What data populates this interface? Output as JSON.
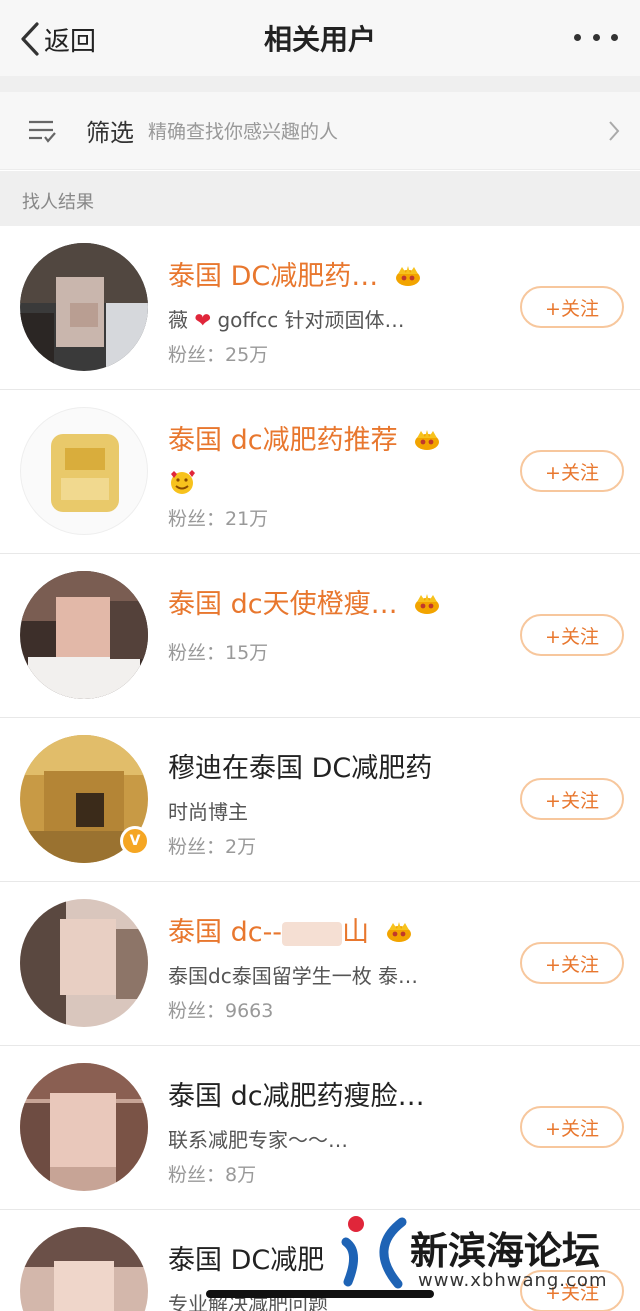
{
  "header": {
    "back_label": "返回",
    "title": "相关用户"
  },
  "filter": {
    "label": "筛选",
    "hint": "精确查找你感兴趣的人"
  },
  "section": {
    "label": "找人结果"
  },
  "follow_label": "+关注",
  "users": [
    {
      "name": "泰国 DC减肥药…",
      "desc_prefix": "薇",
      "desc_suffix": "goffcc  针对顽固体…",
      "fans": "粉丝：25万"
    },
    {
      "name": "泰国 dc减肥药推荐",
      "fans": "粉丝：21万"
    },
    {
      "name": "泰国 dc天使橙瘦…",
      "fans": "粉丝：15万"
    },
    {
      "name": "穆迪在泰国 DC减肥药",
      "desc": "时尚博主",
      "fans": "粉丝：2万"
    },
    {
      "name": "泰国 dc--",
      "name_tail": "山",
      "desc": "泰国dc泰国留学生一枚 泰…",
      "fans": "粉丝：9663"
    },
    {
      "name": "泰国 dc减肥药瘦脸…",
      "desc": "联系减肥专家～～…",
      "fans": "粉丝：8万"
    },
    {
      "name": "泰国 DC减肥",
      "desc": "专业解决减肥问题"
    }
  ],
  "watermark": {
    "title": "新滨海论坛",
    "url": "www.xbhwang.com"
  },
  "colors": {
    "accent": "#e8772e",
    "follow_border": "#f7c79d",
    "verified": "#f5a623"
  }
}
